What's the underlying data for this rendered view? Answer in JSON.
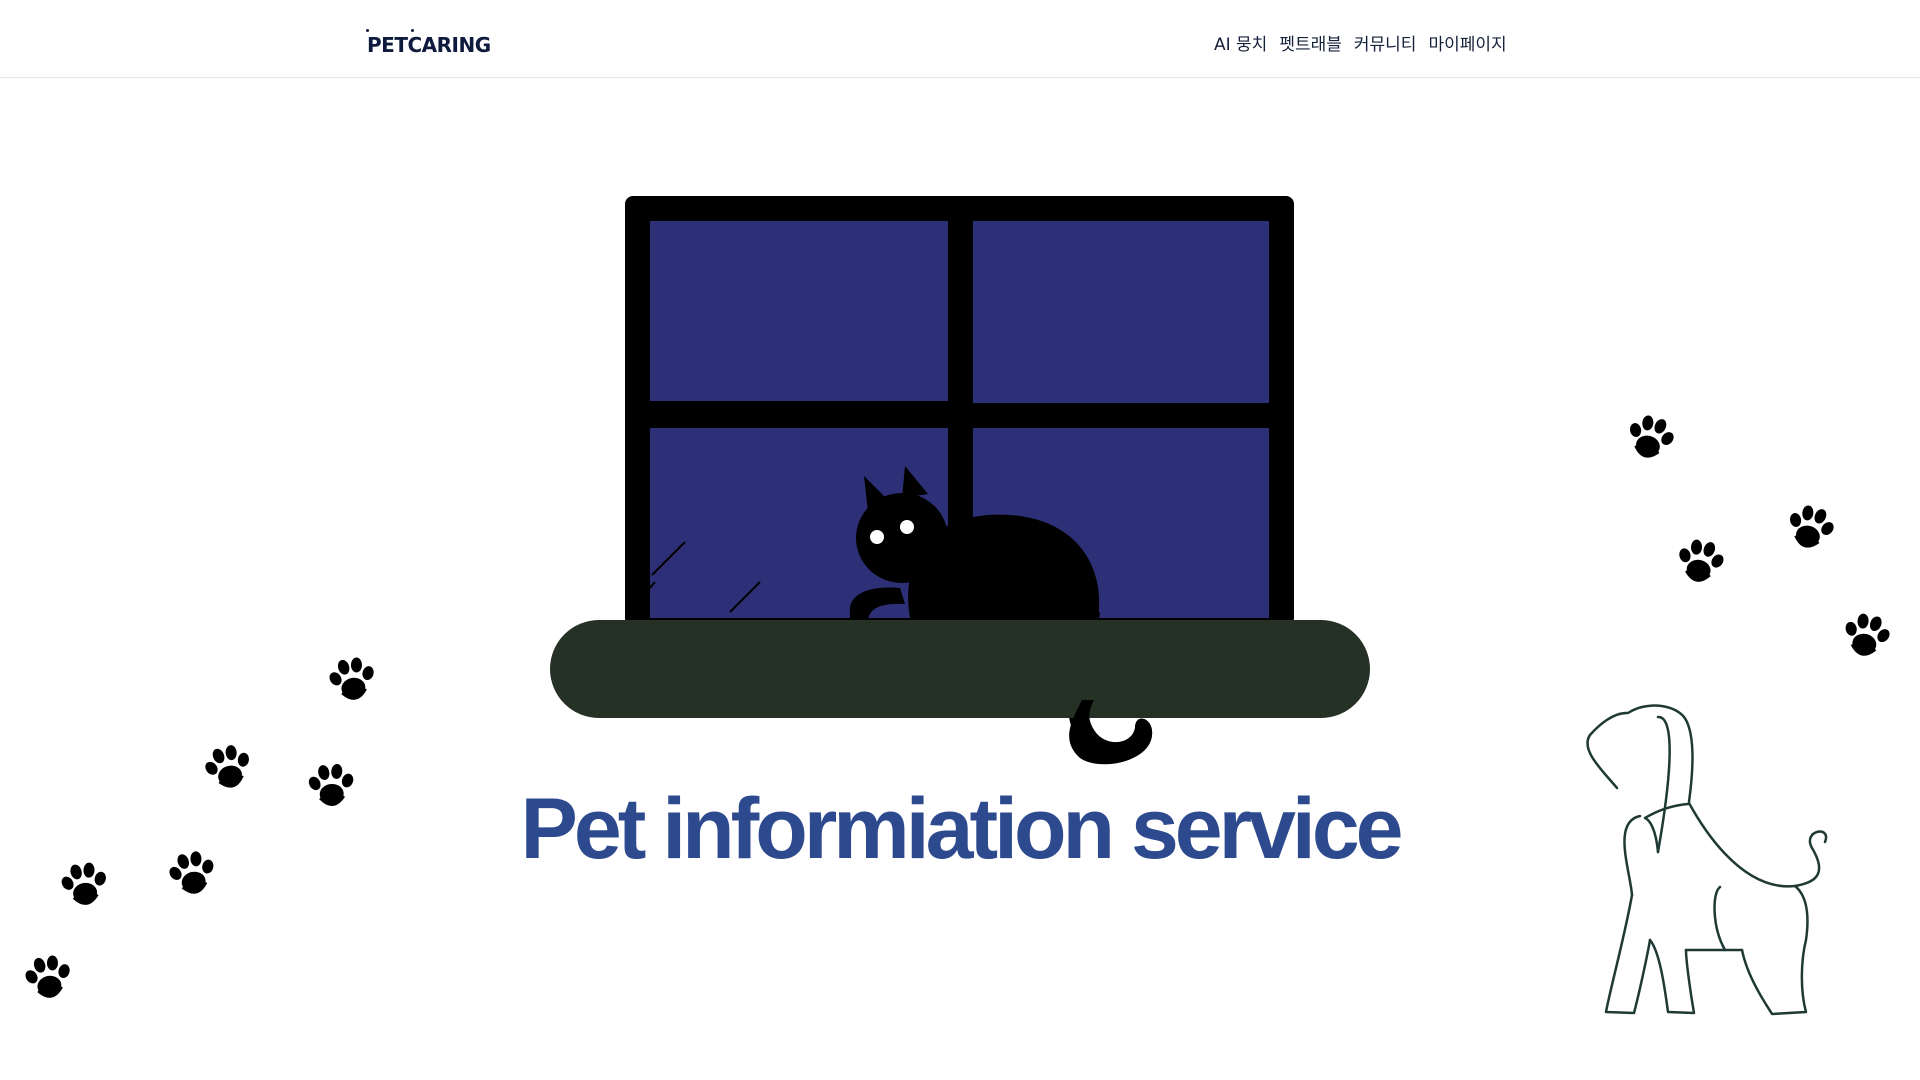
{
  "header": {
    "logo": "PETCARING",
    "nav": [
      {
        "label": "AI 뭉치"
      },
      {
        "label": "펫트래블"
      },
      {
        "label": "커뮤니티"
      },
      {
        "label": "마이페이지"
      }
    ]
  },
  "hero": {
    "title": "Pet informiation service"
  },
  "icons": [
    "paw-print-icon",
    "cat-silhouette-icon",
    "dog-outline-icon",
    "window-illustration"
  ],
  "colors": {
    "window_frame": "#000000",
    "window_glass": "#2d3076",
    "sill": "#263126",
    "title": "#2e4a8f",
    "dog_stroke": "#1f3a34"
  }
}
